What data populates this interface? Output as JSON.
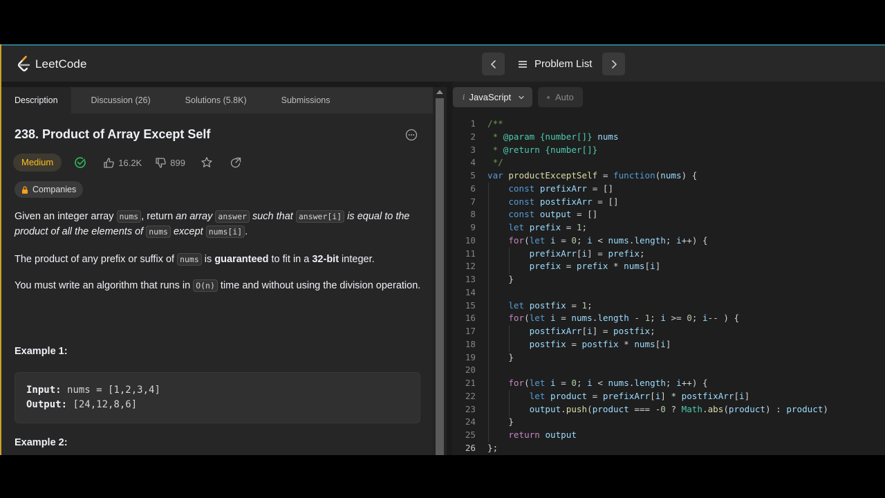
{
  "brand": {
    "name": "LeetCode",
    "color": "#ffa116"
  },
  "nav": {
    "problem_list_label": "Problem List",
    "prev_icon": "chevron-left-icon",
    "next_icon": "chevron-right-icon"
  },
  "tabs": [
    {
      "label": "Description",
      "active": true
    },
    {
      "label": "Discussion (26)",
      "active": false
    },
    {
      "label": "Solutions (5.8K)",
      "active": false
    },
    {
      "label": "Submissions",
      "active": false
    }
  ],
  "problem": {
    "title": "238. Product of Array Except Self",
    "difficulty": "Medium",
    "likes": "16.2K",
    "dislikes": "899",
    "companies_label": "Companies",
    "description": {
      "p1_a": "Given an integer array ",
      "p1_code1": "nums",
      "p1_b": ", return ",
      "p1_em1": "an array",
      "p1_code2": "answer",
      "p1_em2": "such that",
      "p1_code3": "answer[i]",
      "p1_em3": "is equal to the product of all the elements of",
      "p1_code4": "nums",
      "p1_em4": "except",
      "p1_code5": "nums[i]",
      "p1_end": ".",
      "p2_a": "The product of any prefix or suffix of ",
      "p2_code": "nums",
      "p2_b": " is ",
      "p2_bold1": "guaranteed",
      "p2_c": " to fit in a ",
      "p2_bold2": "32-bit",
      "p2_d": " integer.",
      "p3_a": "You must write an algorithm that runs in ",
      "p3_code": "O(n)",
      "p3_b": " time and without using the division operation."
    },
    "example1": {
      "title": "Example 1:",
      "input_label": "Input:",
      "input": "nums = [1,2,3,4]",
      "output_label": "Output:",
      "output": "[24,12,8,6]"
    },
    "example2": {
      "title": "Example 2:"
    }
  },
  "editor": {
    "language": "JavaScript",
    "mode": "Auto",
    "current_line": 26
  },
  "colors": {
    "medium": "#ffc01e",
    "solved": "#2cbb5d",
    "accent_line": "#c9a227"
  }
}
